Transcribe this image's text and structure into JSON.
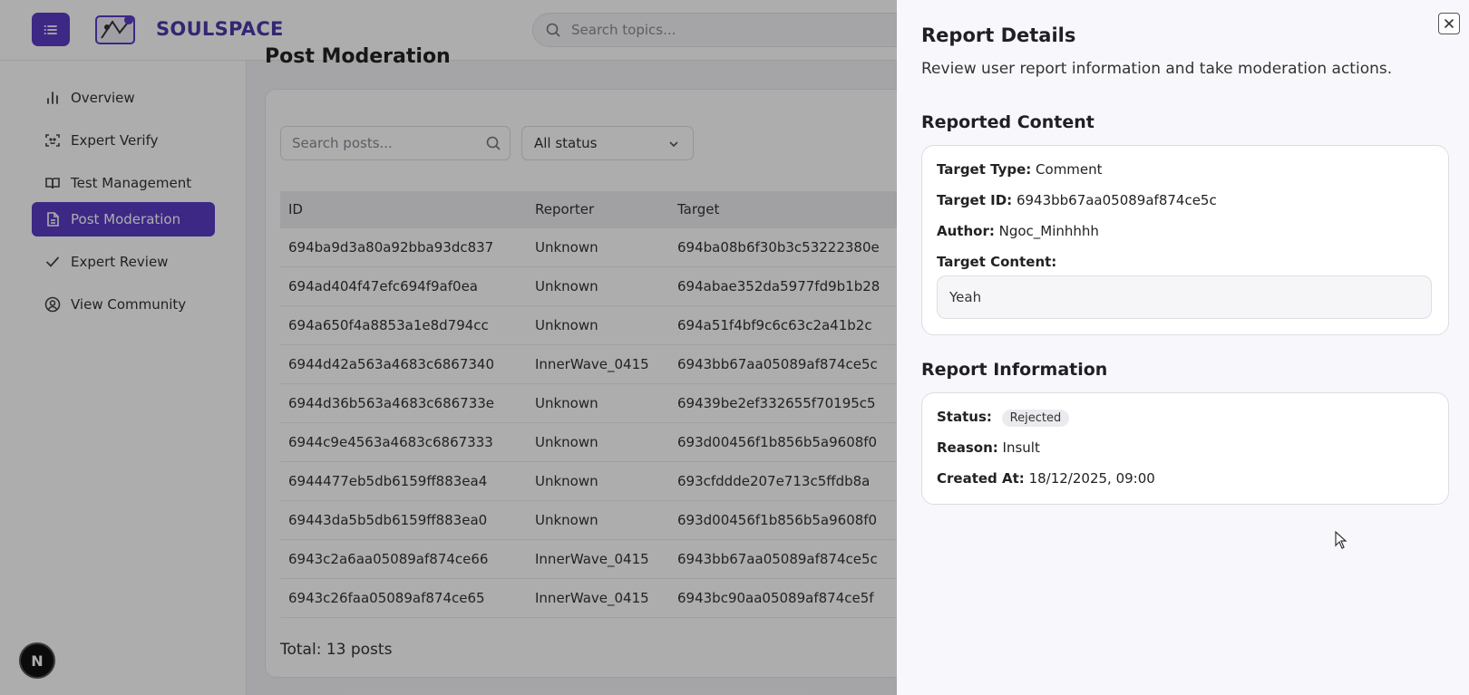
{
  "app": {
    "brand": "SOULSPACE",
    "search_placeholder": "Search topics..."
  },
  "sidebar": {
    "items": [
      {
        "label": "Overview",
        "icon": "bar-chart-icon",
        "active": false
      },
      {
        "label": "Expert Verify",
        "icon": "scan-face-icon",
        "active": false
      },
      {
        "label": "Test Management",
        "icon": "book-open-icon",
        "active": false
      },
      {
        "label": "Post Moderation",
        "icon": "file-text-icon",
        "active": true
      },
      {
        "label": "Expert Review",
        "icon": "check-icon",
        "active": false
      },
      {
        "label": "View Community",
        "icon": "user-circle-icon",
        "active": false
      }
    ],
    "badge": "N"
  },
  "main": {
    "title": "Post Moderation",
    "search_posts_placeholder": "Search posts...",
    "status_filter": "All status",
    "columns": [
      "ID",
      "Reporter",
      "Target"
    ],
    "rows": [
      [
        "694ba9d3a80a92bba93dc837",
        "Unknown",
        "694ba08b6f30b3c53222380e"
      ],
      [
        "694ad404f47efc694f9af0ea",
        "Unknown",
        "694abae352da5977fd9b1b28"
      ],
      [
        "694a650f4a8853a1e8d794cc",
        "Unknown",
        "694a51f4bf9c6c63c2a41b2c"
      ],
      [
        "6944d42a563a4683c6867340",
        "InnerWave_0415",
        "6943bb67aa05089af874ce5c"
      ],
      [
        "6944d36b563a4683c686733e",
        "Unknown",
        "69439be2ef332655f70195c5"
      ],
      [
        "6944c9e4563a4683c6867333",
        "Unknown",
        "693d00456f1b856b5a9608f0"
      ],
      [
        "6944477eb5db6159ff883ea4",
        "Unknown",
        "693cfddde207e713c5ffdb8a"
      ],
      [
        "69443da5b5db6159ff883ea0",
        "Unknown",
        "693d00456f1b856b5a9608f0"
      ],
      [
        "6943c2a6aa05089af874ce66",
        "InnerWave_0415",
        "6943bb67aa05089af874ce5c"
      ],
      [
        "6943c26faa05089af874ce65",
        "InnerWave_0415",
        "6943bc90aa05089af874ce5f"
      ]
    ],
    "total": "Total: 13 posts"
  },
  "drawer": {
    "title": "Report Details",
    "subtitle": "Review user report information and take moderation actions.",
    "reported_content": {
      "heading": "Reported Content",
      "target_type_label": "Target Type:",
      "target_type": "Comment",
      "target_id_label": "Target ID:",
      "target_id": "6943bb67aa05089af874ce5c",
      "author_label": "Author:",
      "author": "Ngoc_Minhhhh",
      "target_content_label": "Target Content:",
      "target_content": "Yeah"
    },
    "report_info": {
      "heading": "Report Information",
      "status_label": "Status:",
      "status": "Rejected",
      "reason_label": "Reason:",
      "reason": "Insult",
      "created_label": "Created At:",
      "created": "18/12/2025, 09:00"
    }
  },
  "colors": {
    "accent": "#5b3cc4",
    "brand_text": "#4b3aa8"
  }
}
